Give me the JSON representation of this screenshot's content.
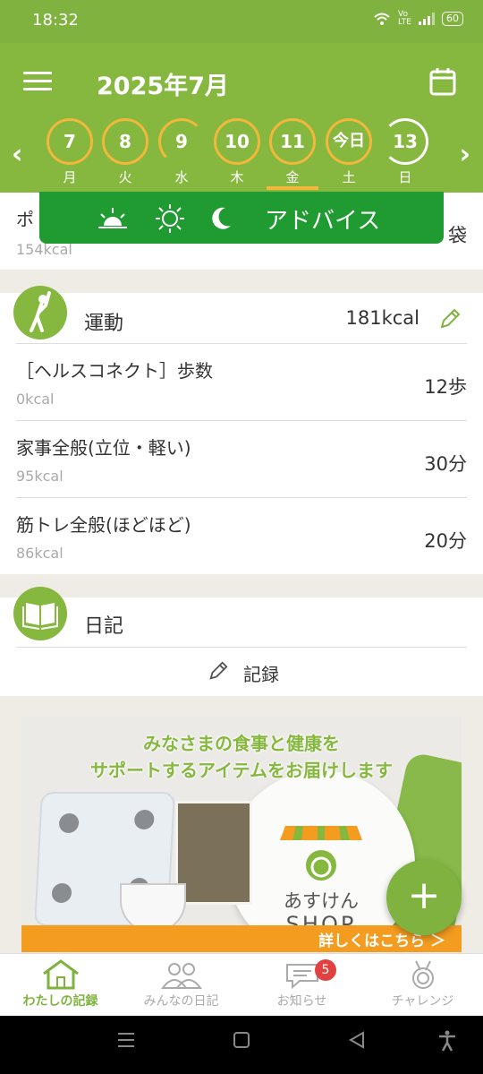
{
  "status": {
    "time": "18:32",
    "battery": "60"
  },
  "header": {
    "title": "2025年7月"
  },
  "days": [
    {
      "num": "7",
      "wd": "月"
    },
    {
      "num": "8",
      "wd": "火"
    },
    {
      "num": "9",
      "wd": "水"
    },
    {
      "num": "10",
      "wd": "木"
    },
    {
      "num": "11",
      "wd": "金"
    },
    {
      "num": "今日",
      "wd": "土"
    },
    {
      "num": "13",
      "wd": "日"
    }
  ],
  "advice": {
    "label": "アドバイス"
  },
  "food_partial": {
    "name": "ポ",
    "kcal": "154kcal",
    "amount": "袋"
  },
  "exercise": {
    "title": "運動",
    "total": "181kcal",
    "items": [
      {
        "name": "［ヘルスコネクト］歩数",
        "kcal": "0kcal",
        "amount": "12歩"
      },
      {
        "name": "家事全般(立位・軽い)",
        "kcal": "95kcal",
        "amount": "30分"
      },
      {
        "name": "筋トレ全般(ほどほど)",
        "kcal": "86kcal",
        "amount": "20分"
      }
    ]
  },
  "diary": {
    "title": "日記",
    "record_label": "記録"
  },
  "banner": {
    "line1": "みなさまの食事と健康を",
    "line2": "サポートするアイテムをお届けします",
    "shop_name": "あすけん",
    "shop_sub": "SHOP",
    "cta": "詳しくはこちら ＞"
  },
  "fab": {
    "label": "+"
  },
  "tabs": [
    {
      "label": "わたしの記録"
    },
    {
      "label": "みんなの日記"
    },
    {
      "label": "お知らせ",
      "badge": "5"
    },
    {
      "label": "チャレンジ"
    }
  ],
  "colors": {
    "primary": "#86b840",
    "accent": "#f2b73b",
    "advice": "#1f9b31",
    "badge": "#e24141"
  }
}
